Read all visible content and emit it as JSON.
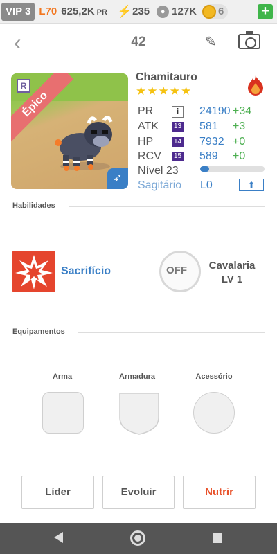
{
  "topbar": {
    "vip": "VIP 3",
    "level": "L70",
    "power": "625,2K",
    "power_unit": "PR",
    "energy": "235",
    "food": "127K",
    "coins": "6",
    "add_icon": "plus-icon"
  },
  "header": {
    "count": "42",
    "back_icon": "chevron-left-icon",
    "edit_icon": "pencil-icon",
    "camera_icon": "camera-icon"
  },
  "pet": {
    "name": "Chamitauro",
    "rarity": "Épico",
    "rank_badge": "R",
    "stars": "★★★★★",
    "element_icon": "fire-icon",
    "stats": [
      {
        "label": "PR",
        "badge": "i",
        "value": "24190",
        "bonus": "+34"
      },
      {
        "label": "ATK",
        "badge": "13",
        "value": "581",
        "bonus": "+3"
      },
      {
        "label": "HP",
        "badge": "14",
        "value": "7932",
        "bonus": "+0"
      },
      {
        "label": "RCV",
        "badge": "15",
        "value": "589",
        "bonus": "+0"
      }
    ],
    "level_label": "Nível 23",
    "level_progress": 0.14,
    "sign_label": "Sagitário",
    "sign_value": "L0",
    "upgrade_icon": "arrow-up-icon"
  },
  "skills": {
    "title": "Habilidades",
    "primary": {
      "name": "Sacrifício"
    },
    "secondary": {
      "status": "OFF",
      "name": "Cavalaria",
      "level": "LV 1"
    }
  },
  "equipment": {
    "title": "Equipamentos",
    "slots": [
      {
        "label": "Arma"
      },
      {
        "label": "Armadura"
      },
      {
        "label": "Acessório"
      }
    ]
  },
  "actions": {
    "leader": "Líder",
    "evolve": "Evoluir",
    "feed": "Nutrir"
  },
  "colors": {
    "accent_blue": "#3a7fc6",
    "bonus_green": "#4caf50",
    "epic_red": "#e86f70",
    "feed_orange": "#e8512a"
  }
}
